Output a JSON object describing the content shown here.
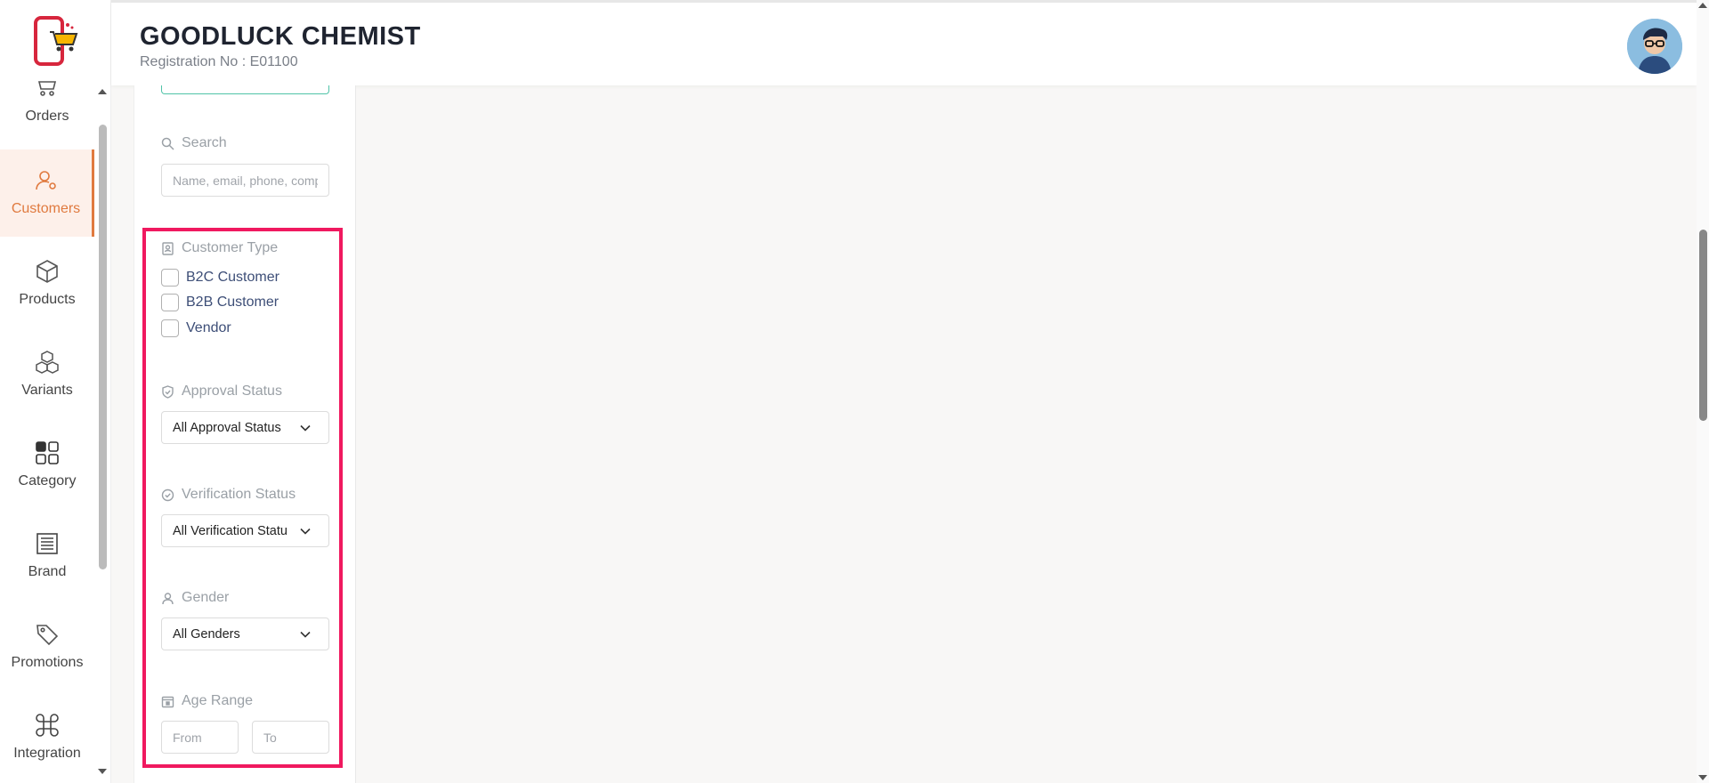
{
  "header": {
    "title": "GOODLUCK CHEMIST",
    "registration": "Registration No : E01100"
  },
  "sidebar": {
    "items": [
      {
        "label": "Orders",
        "icon": "orders-icon"
      },
      {
        "label": "Customers",
        "icon": "customers-icon",
        "active": true
      },
      {
        "label": "Products",
        "icon": "box-icon"
      },
      {
        "label": "Variants",
        "icon": "cubes-icon"
      },
      {
        "label": "Category",
        "icon": "grid-icon"
      },
      {
        "label": "Brand",
        "icon": "brand-icon"
      },
      {
        "label": "Promotions",
        "icon": "tag-icon"
      },
      {
        "label": "Integration",
        "icon": "command-icon"
      }
    ]
  },
  "filters": {
    "search": {
      "label": "Search",
      "placeholder": "Name, email, phone, company"
    },
    "customer_type": {
      "label": "Customer Type",
      "options": [
        "B2C Customer",
        "B2B Customer",
        "Vendor"
      ]
    },
    "approval_status": {
      "label": "Approval Status",
      "value": "All Approval Status"
    },
    "verification_status": {
      "label": "Verification Status",
      "value": "All Verification Status"
    },
    "gender": {
      "label": "Gender",
      "value": "All Genders"
    },
    "age_range": {
      "label": "Age Range",
      "from_placeholder": "From",
      "to_placeholder": "To"
    }
  },
  "colors": {
    "accent": "#e07a3f",
    "highlight": "#f0195f",
    "checkbox_label": "#3d4e77"
  }
}
